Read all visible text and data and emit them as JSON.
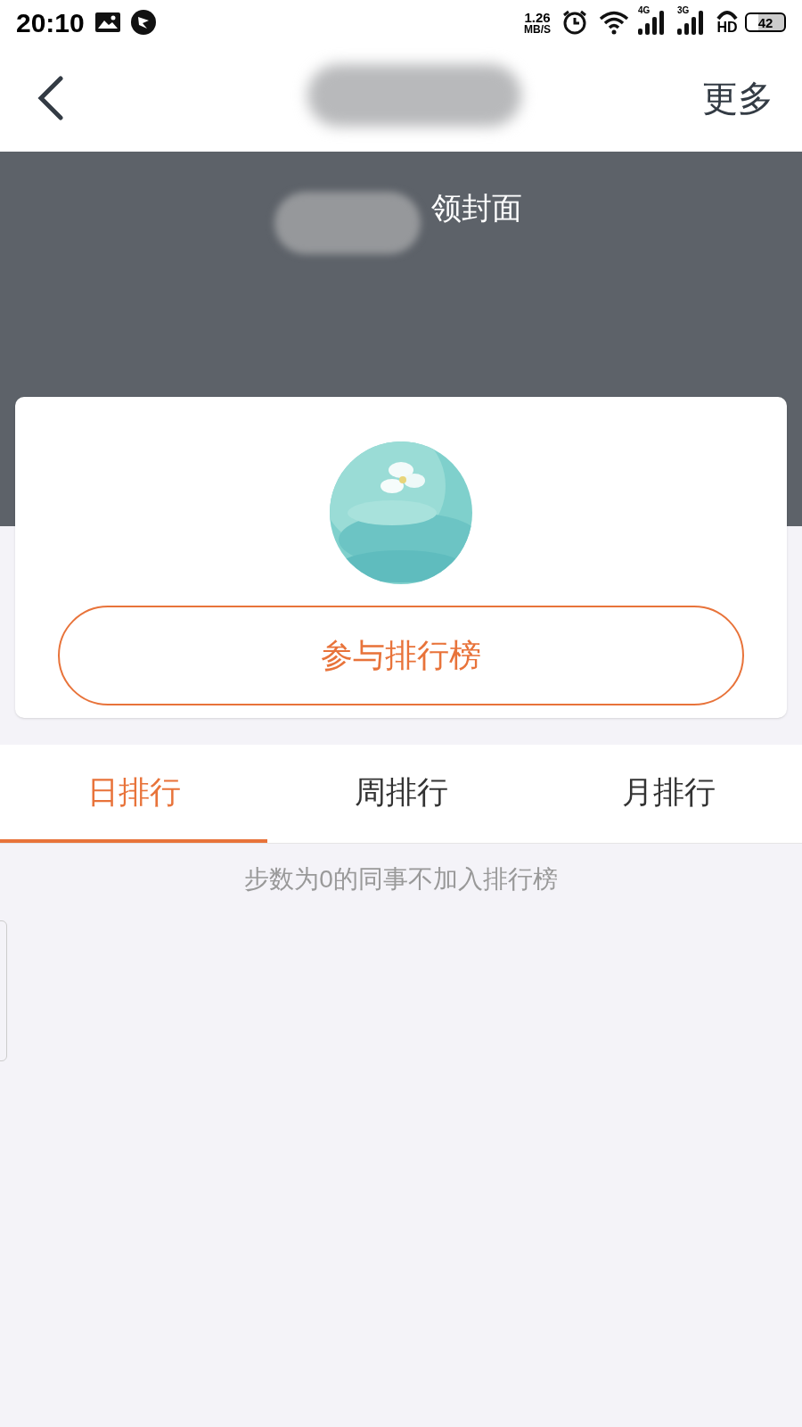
{
  "status_bar": {
    "time": "20:10",
    "speed_value": "1.26",
    "speed_unit": "MB/S",
    "network_1": "4G",
    "network_2": "3G",
    "hd": "HD",
    "battery": "42"
  },
  "nav_bar": {
    "more": "更多"
  },
  "banner": {
    "text": "领封面"
  },
  "join_button": {
    "label": "参与排行榜"
  },
  "tabs": [
    {
      "label": "日排行",
      "selected": true
    },
    {
      "label": "周排行",
      "selected": false
    },
    {
      "label": "月排行",
      "selected": false
    }
  ],
  "note": "步数为0的同事不加入排行榜"
}
